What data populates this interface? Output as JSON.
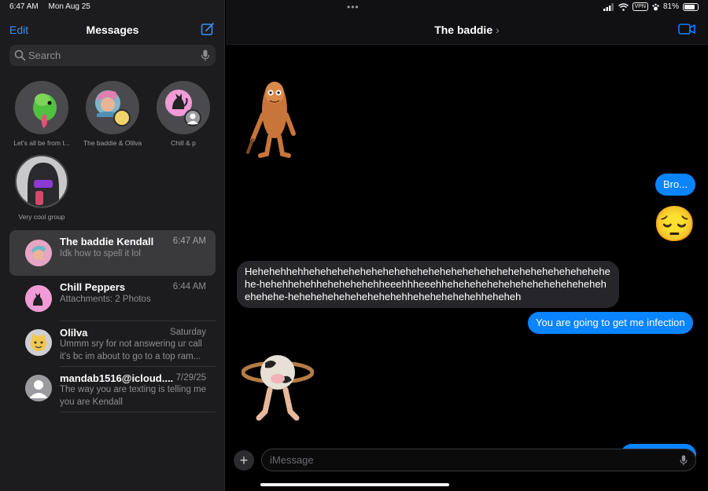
{
  "status": {
    "time": "6:47 AM",
    "date": "Mon Aug 25",
    "vpn": "VPN",
    "battery": "81%",
    "battery_level": 0.81
  },
  "sidebar": {
    "edit_label": "Edit",
    "title": "Messages",
    "search": {
      "placeholder": "Search"
    },
    "pinned": [
      {
        "label": "Let's all be from t..."
      },
      {
        "label": "The baddie & Olilva"
      },
      {
        "label": "Chill & p"
      },
      {
        "label": "Very cool group"
      }
    ],
    "conversations": [
      {
        "name": "The baddie Kendall",
        "time": "6:47 AM",
        "preview": "Idk how to spell it lol"
      },
      {
        "name": "Chill Peppers",
        "time": "6:44 AM",
        "preview": "Attachments: 2 Photos"
      },
      {
        "name": "Olilva",
        "time": "Saturday",
        "preview": "Ummm sry for not answering ur call it's bc im about to go to a top ram..."
      },
      {
        "name": "mandab1516@icloud....",
        "time": "7/29/25",
        "preview": "The way you are texting is telling me you are Kendall"
      }
    ]
  },
  "chat": {
    "title": "The baddie",
    "messages": [
      {
        "kind": "out",
        "text": "Bro..."
      },
      {
        "kind": "emoji",
        "text": "😔"
      },
      {
        "kind": "in",
        "text": "Hehehehhehhehehehehehehehehehehehehehehehehehehehehehehehehehehehe-hehehhehehhehehehehehheeehhheeehhehehehehehehehehehehehehehehehehehe-hehehehehehehehehehehhehehehehehehheheheh"
      },
      {
        "kind": "out",
        "text": "You are going to get me infection"
      }
    ],
    "composer": {
      "placeholder": "iMessage"
    }
  },
  "colors": {
    "accent": "#0a84ff",
    "sidebar_bg": "#1c1c1e",
    "incoming_bubble": "#26262a"
  }
}
